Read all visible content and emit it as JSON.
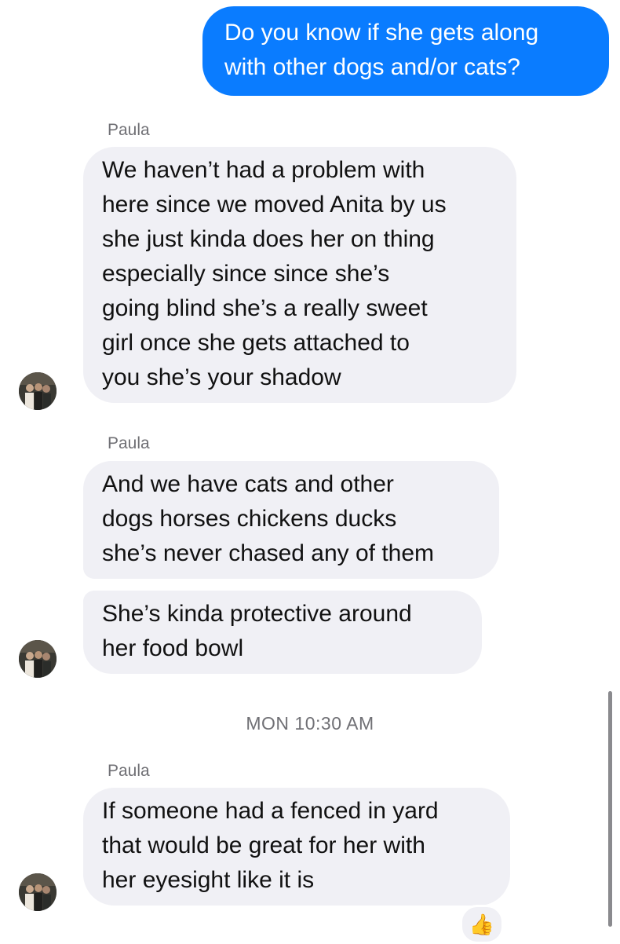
{
  "messages": [
    {
      "direction": "outgoing",
      "lines": [
        "Do you know if she gets along",
        "with other dogs and/or cats?"
      ]
    },
    {
      "direction": "incoming",
      "sender": "Paula",
      "lines": [
        "We haven’t had a problem with",
        "here since we moved Anita by us",
        "she just kinda does her on thing",
        "especially since since she’s",
        "going blind she’s a really sweet",
        "girl once she gets attached to",
        "you she’s your shadow"
      ]
    },
    {
      "direction": "incoming",
      "sender": "Paula",
      "lines": [
        "And we have cats and other",
        "dogs horses chickens ducks",
        "she’s never chased any of them"
      ]
    },
    {
      "direction": "incoming",
      "lines": [
        "She’s kinda protective around",
        "her food bowl"
      ]
    },
    {
      "direction": "incoming",
      "sender": "Paula",
      "lines": [
        "If someone had a fenced in yard",
        "that would be great for her with",
        "her eyesight like it is"
      ]
    }
  ],
  "timestamp": "MON 10:30 AM",
  "reaction": {
    "emoji": "👍",
    "icon": "thumbs-up-icon"
  },
  "colors": {
    "outgoing_bubble": "#0a7cff",
    "incoming_bubble": "#f0f0f5",
    "meta_text": "#707075"
  }
}
